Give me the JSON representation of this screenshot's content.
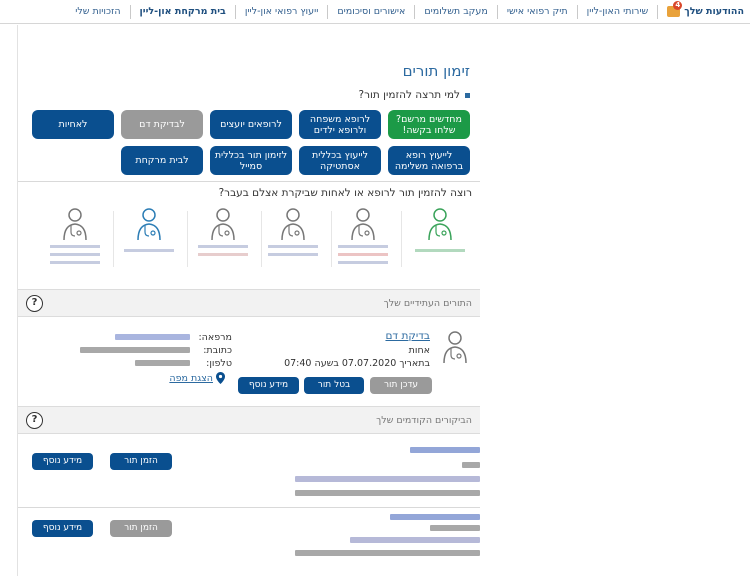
{
  "topnav": {
    "notifications": "ההודעות שלך",
    "notification_count": "4",
    "items": [
      "שירותי האון-ליין",
      "תיק רפואי אישי",
      "מעקב תשלומים",
      "אישורים וסיכומים",
      "ייעוץ רפואי און-ליין",
      "בית מרקחת און-ליין",
      "הזכויות שלי"
    ]
  },
  "page": {
    "title": "זימון תורים",
    "who_question": "למי תרצה להזמין תור?",
    "past_question": "רוצה להזמין תור לרופא או לאחות שביקרת אצלם בעבר?"
  },
  "tiles": [
    {
      "label": "מחדשים מרשם? שלחו בקשה!",
      "color": "green"
    },
    {
      "label": "לרופא משפחה ולרופא ילדים",
      "color": "blue"
    },
    {
      "label": "לרופאים יועצים",
      "color": "blue"
    },
    {
      "label": "לבדיקת דם",
      "color": "gray"
    },
    {
      "label": "לאחיות",
      "color": "blue"
    },
    {
      "label": "לייעוץ רופא ברפואה משלימה",
      "color": "blue"
    },
    {
      "label": "לייעוץ בכללית אסתטיקה",
      "color": "blue"
    },
    {
      "label": "לזימון תור בכללית סמייל",
      "color": "blue"
    },
    {
      "label": "לבית מרקחת",
      "color": "blue"
    }
  ],
  "future": {
    "section_title": "התורים העתידיים שלך",
    "help": "?",
    "appointment": {
      "type": "בדיקת דם",
      "role": "אחות",
      "when": "בתאריך 07.07.2020 בשעה 07:40",
      "clinic_label": "מרפאה:",
      "address_label": "כתובת:",
      "phone_label": "טלפון:",
      "map_link": "הצגת מפה",
      "btn_update": "עדכן תור",
      "btn_cancel": "בטל תור",
      "btn_more": "מידע נוסף"
    }
  },
  "past": {
    "section_title": "הביקורים הקודמים שלך",
    "help": "?",
    "visits": [
      {
        "btn_book": "הזמן תור",
        "btn_more": "מידע נוסף",
        "book_enabled": true
      },
      {
        "btn_book": "הזמן תור",
        "btn_more": "מידע נוסף",
        "book_enabled": false
      }
    ]
  },
  "colors": {
    "accent": "#0a4f8f",
    "green": "#1c9a47",
    "disabled": "#9a9a9a",
    "link": "#2c6aa0"
  },
  "icons": [
    "doctor-icon",
    "map-pin-icon",
    "help-icon"
  ]
}
